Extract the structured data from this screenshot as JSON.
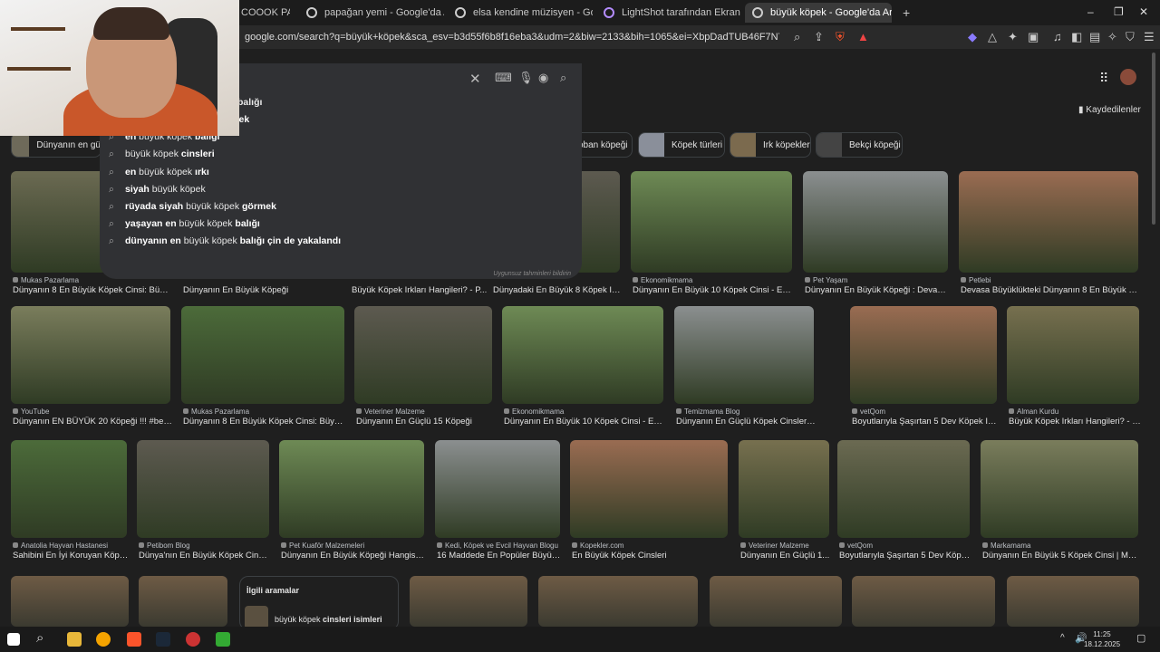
{
  "tabs": [
    {
      "label": "COOOK PARDO",
      "active": false
    },
    {
      "label": "papağan yemi - Google'da Ara",
      "active": false
    },
    {
      "label": "elsa kendine müzisyen - Google'da A",
      "active": false
    },
    {
      "label": "LightShot tarafından Ekran Görüntüs",
      "active": false
    },
    {
      "label": "büyük köpek - Google'da Ara",
      "active": true
    }
  ],
  "new_tab": "+",
  "window_controls": {
    "minimize": "–",
    "maximize": "❐",
    "close": "✕"
  },
  "address_bar": {
    "url": "google.com/search?q=büyük+köpek&sca_esv=b3d55f6b8f16eba3&udm=2&biw=2133&bih=1065&ei=XbpDadTUB46F7NYPru_G-A4&ved=0a..."
  },
  "search": {
    "partial_top": "balığı",
    "suggestions": [
      {
        "pre": "rüyada ",
        "mid": "büyük köpek ",
        "post": "görmek",
        "bold_pre": true,
        "bold_post": true
      },
      {
        "pre": "en ",
        "mid": "büyük köpek ",
        "post": "balığı",
        "bold_pre": true,
        "bold_post": true
      },
      {
        "pre": "",
        "mid": "büyük köpek ",
        "post": "cinsleri",
        "bold_pre": false,
        "bold_post": true
      },
      {
        "pre": "en ",
        "mid": "büyük köpek ",
        "post": "ırkı",
        "bold_pre": true,
        "bold_post": true
      },
      {
        "pre": "siyah ",
        "mid": "büyük köpek",
        "post": "",
        "bold_pre": true,
        "bold_post": false
      },
      {
        "pre": "rüyada siyah ",
        "mid": "büyük köpek ",
        "post": "görmek",
        "bold_pre": true,
        "bold_post": true
      },
      {
        "pre": "yaşayan en ",
        "mid": "büyük köpek ",
        "post": "balığı",
        "bold_pre": true,
        "bold_post": true
      },
      {
        "pre": "dünyanın en ",
        "mid": "büyük köpek ",
        "post": "balığı çin de yakalandı",
        "bold_pre": true,
        "bold_post": true
      }
    ],
    "footnote": "Uygunsuz tahminleri bildirin"
  },
  "chips": [
    {
      "label": "Dünyanın en gü"
    },
    {
      "label": "oban köpeği"
    },
    {
      "label": "Köpek türleri"
    },
    {
      "label": "Irk köpekler"
    },
    {
      "label": "Bekçi köpeği"
    }
  ],
  "saved_label": "Kaydedilenler",
  "rows": [
    [
      {
        "source": "Mukas Pazarlama",
        "title": "Dünyanın 8 En Büyük Köpek Cinsi: Büyükl..."
      },
      {
        "source": "",
        "title": "Dünyanın En Büyük Köpeği"
      },
      {
        "source": "",
        "title": "Büyük Köpek Irkları Hangileri? - P..."
      },
      {
        "source": "",
        "title": "Dünyadaki En Büyük 8 Köpek Irkı..."
      },
      {
        "source": "Ekonomikmama",
        "title": "Dünyanın En Büyük 10 Köpek Cinsi - Ekon..."
      },
      {
        "source": "Pet Yaşam",
        "title": "Dünyanın En Büyük Köpeği : Devasa ..."
      },
      {
        "source": "Petlebi",
        "title": "Devasa Büyüklükteki Dünyanın 8 En Büyük Köp..."
      }
    ],
    [
      {
        "source": "YouTube",
        "title": "Dünyanın EN BÜYÜK 20 Köpeği !!! #belge..."
      },
      {
        "source": "Mukas Pazarlama",
        "title": "Dünyanın 8 En Büyük Köpek Cinsi: Büyükl..."
      },
      {
        "source": "Veteriner Malzeme",
        "title": "Dünyanın En Güçlü 15 Köpeği"
      },
      {
        "source": "Ekonomikmama",
        "title": "Dünyanın En Büyük 10 Köpek Cinsi - Eko..."
      },
      {
        "source": "Temizmama Blog",
        "title": "Dünyanın En Güçlü Köpek Cinsleri ve Özell..."
      },
      {
        "source": "vetQom",
        "title": "Boyutlarıyla Şaşırtan 5 Dev Köpek Irkı..."
      },
      {
        "source": "Alman Kurdu",
        "title": "Büyük Köpek Irkları Hangileri? - P..."
      }
    ],
    [
      {
        "source": "Anatolia Hayvan Hastanesi",
        "title": "Sahibini En İyi Koruyan Köpe..."
      },
      {
        "source": "Petibom Blog",
        "title": "Dünya'nın En Büyük Köpek Cinsl..."
      },
      {
        "source": "Pet Kuaför Malzemeleri",
        "title": "Dünyanın En Büyük Köpeği Hangisidir..."
      },
      {
        "source": "Kedi, Köpek ve Evcil Hayvan Blogu",
        "title": "16 Maddede En Popüler Büyük ..."
      },
      {
        "source": "Kopekler.com",
        "title": "En Büyük Köpek Cinsleri"
      },
      {
        "source": "Veteriner Malzeme",
        "title": "Dünyanın En Güçlü 1..."
      },
      {
        "source": "vetQom",
        "title": "Boyutlarıyla Şaşırtan 5 Dev Köpe..."
      },
      {
        "source": "Markamama",
        "title": "Dünyanın En Büyük 5 Köpek Cinsi | Mark..."
      }
    ]
  ],
  "related": {
    "heading": "İlgili aramalar",
    "item_pre": "büyük köpek ",
    "item_bold": "cinsleri isimleri"
  },
  "taskbar": {
    "time": "11:25",
    "date": "18.12.2025"
  }
}
